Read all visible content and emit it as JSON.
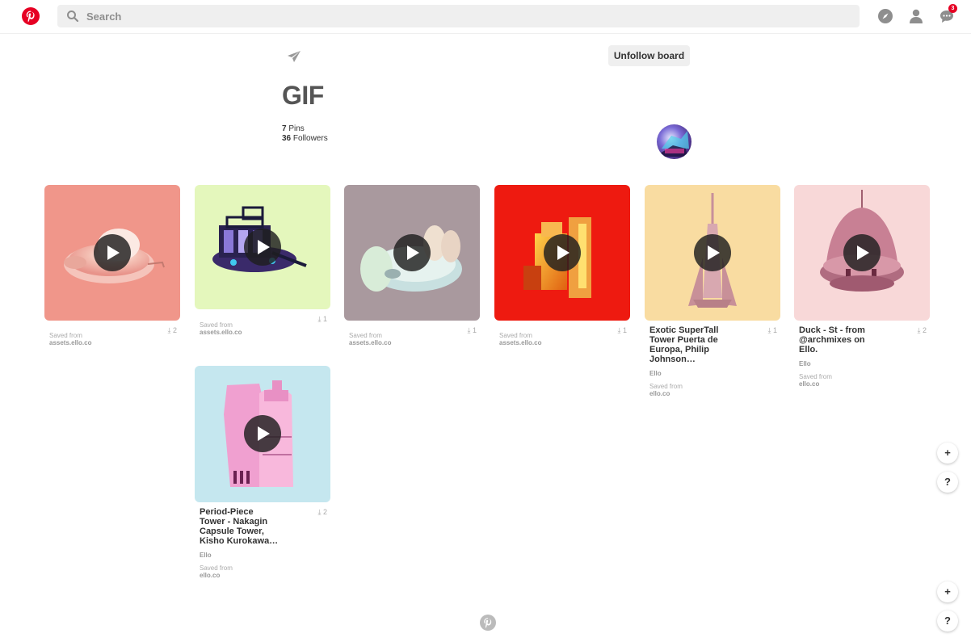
{
  "header": {
    "search_placeholder": "Search",
    "notification_count": "3",
    "brand_color": "#e60023"
  },
  "board": {
    "title": "GIF",
    "pins_count": "7",
    "pins_label": "Pins",
    "followers_count": "36",
    "followers_label": "Followers",
    "unfollow_label": "Unfollow board"
  },
  "pins": [
    {
      "title": "",
      "author": "",
      "pin_count": "2",
      "saved_label": "Saved from",
      "domain": "assets.ello.co",
      "bg": "#f0968a"
    },
    {
      "title": "",
      "author": "",
      "pin_count": "1",
      "saved_label": "Saved from",
      "domain": "assets.ello.co",
      "bg": "#e4f7bc"
    },
    {
      "title": "",
      "author": "",
      "pin_count": "1",
      "saved_label": "Saved from",
      "domain": "assets.ello.co",
      "bg": "#a9999e"
    },
    {
      "title": "",
      "author": "",
      "pin_count": "1",
      "saved_label": "Saved from",
      "domain": "assets.ello.co",
      "bg": "#ee1a10"
    },
    {
      "title": "Exotic SuperTall Tower Puerta de Europa, Philip Johnson…",
      "author": "Ello",
      "pin_count": "1",
      "saved_label": "Saved from",
      "domain": "ello.co",
      "bg": "#f9dca1"
    },
    {
      "title": "Duck - St - from @archmixes on Ello.",
      "author": "Ello",
      "pin_count": "2",
      "saved_label": "Saved from",
      "domain": "ello.co",
      "bg": "#f8d8d8"
    },
    {
      "title": "Period-Piece Tower - Nakagin Capsule Tower, Kisho Kurokawa…",
      "author": "Ello",
      "pin_count": "2",
      "saved_label": "Saved from",
      "domain": "ello.co",
      "bg": "#c5e7ef"
    }
  ],
  "fab": {
    "add_label": "+",
    "help_label": "?"
  }
}
